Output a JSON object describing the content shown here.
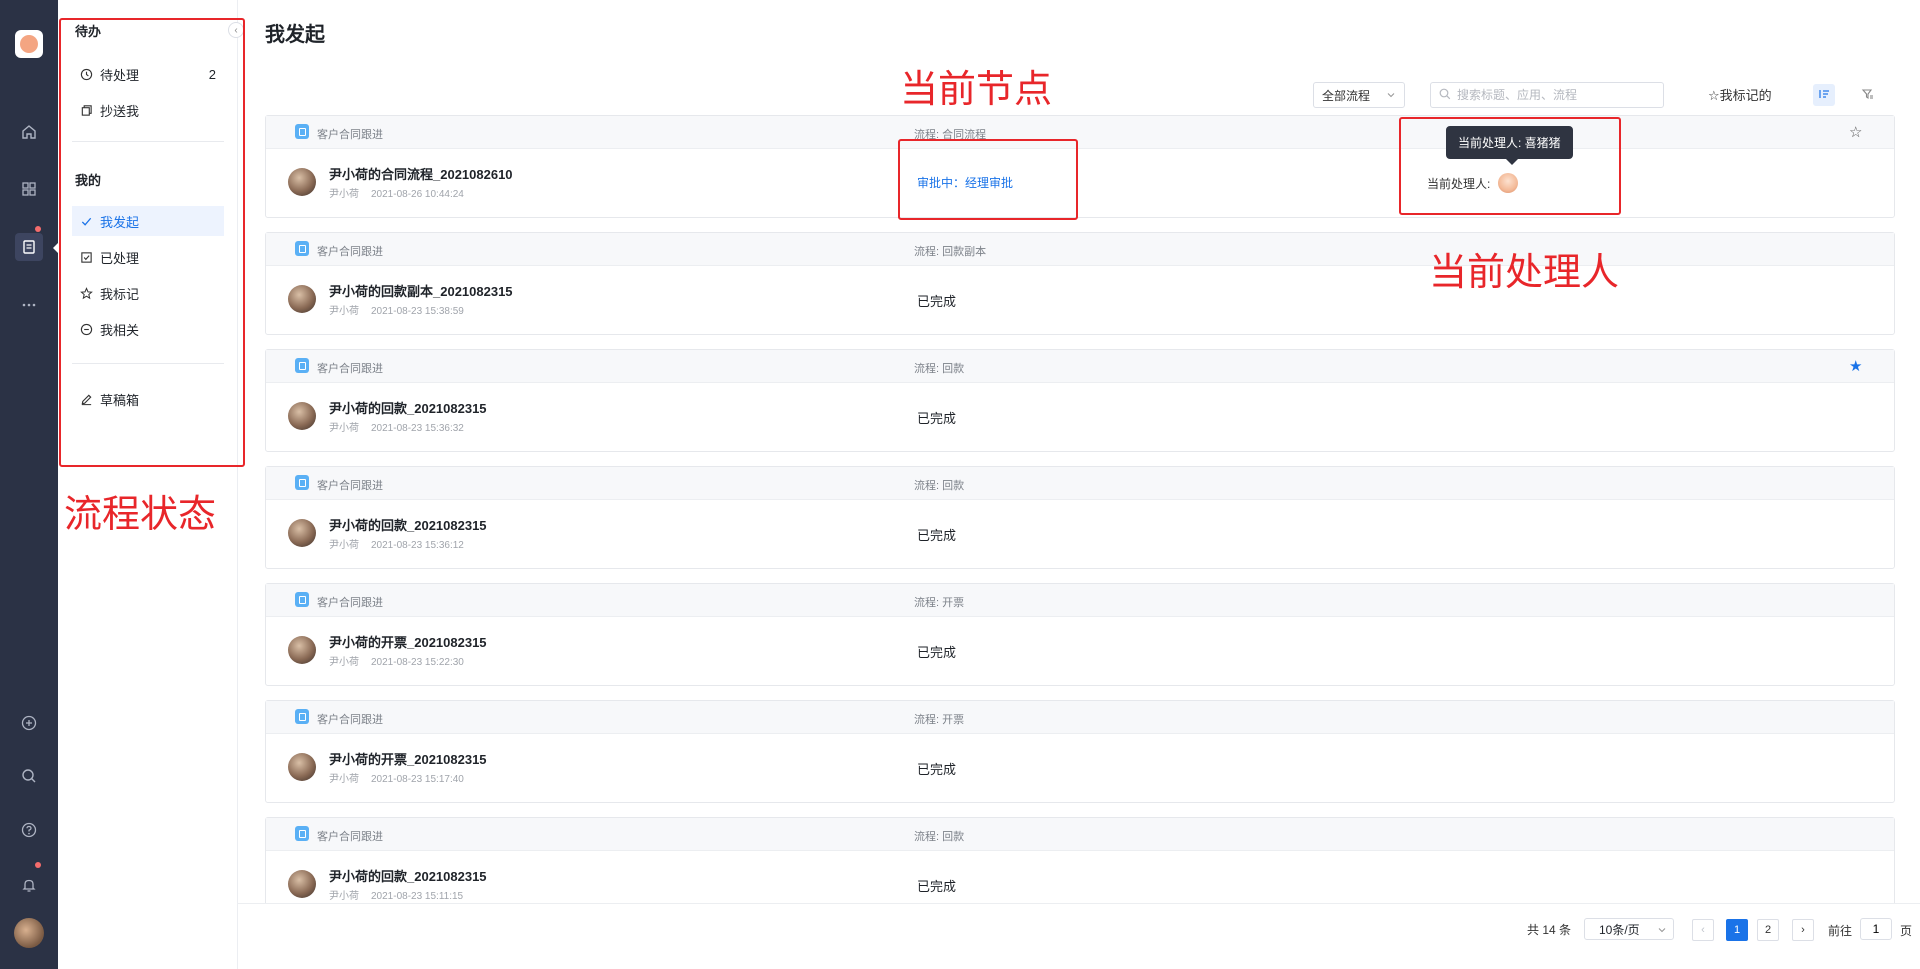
{
  "rail": {
    "items": [
      {
        "icon": "home-icon"
      },
      {
        "icon": "apps-icon"
      },
      {
        "icon": "workflow-icon",
        "active": true,
        "badge": true
      },
      {
        "icon": "more-icon"
      }
    ],
    "bottom": [
      {
        "icon": "add-circle-icon"
      },
      {
        "icon": "search-icon"
      },
      {
        "icon": "help-icon"
      },
      {
        "icon": "bell-icon",
        "badge": true
      }
    ]
  },
  "sidebar": {
    "todo_heading": "待办",
    "todo_items": [
      {
        "label": "待处理",
        "count": "2",
        "icon": "clock-icon"
      },
      {
        "label": "抄送我",
        "icon": "copy-icon"
      }
    ],
    "mine_heading": "我的",
    "mine_items": [
      {
        "label": "我发起",
        "icon": "check-icon",
        "active": true
      },
      {
        "label": "已处理",
        "icon": "checkbox-icon"
      },
      {
        "label": "我标记",
        "icon": "star-icon"
      },
      {
        "label": "我相关",
        "icon": "minus-circle-icon"
      }
    ],
    "draft_label": "草稿箱"
  },
  "page": {
    "title": "我发起",
    "filter_value": "全部流程",
    "search_placeholder": "搜索标题、应用、流程",
    "marked_label": "☆我标记的"
  },
  "annotations": {
    "node": "当前节点",
    "handler": "当前处理人",
    "status": "流程状态"
  },
  "tooltip": "当前处理人: 喜猪猪",
  "records": [
    {
      "app": "客户合同跟进",
      "flow": "流程: 合同流程",
      "title": "尹小荷的合同流程_2021082610",
      "user": "尹小荷",
      "time": "2021-08-26 10:44:24",
      "status": "审批中：经理审批",
      "pending": true,
      "handler_label": "当前处理人:",
      "starred": false
    },
    {
      "app": "客户合同跟进",
      "flow": "流程: 回款副本",
      "title": "尹小荷的回款副本_2021082315",
      "user": "尹小荷",
      "time": "2021-08-23 15:38:59",
      "status": "已完成",
      "starred": null
    },
    {
      "app": "客户合同跟进",
      "flow": "流程: 回款",
      "title": "尹小荷的回款_2021082315",
      "user": "尹小荷",
      "time": "2021-08-23 15:36:32",
      "status": "已完成",
      "starred": true
    },
    {
      "app": "客户合同跟进",
      "flow": "流程: 回款",
      "title": "尹小荷的回款_2021082315",
      "user": "尹小荷",
      "time": "2021-08-23 15:36:12",
      "status": "已完成",
      "starred": null
    },
    {
      "app": "客户合同跟进",
      "flow": "流程: 开票",
      "title": "尹小荷的开票_2021082315",
      "user": "尹小荷",
      "time": "2021-08-23 15:22:30",
      "status": "已完成",
      "starred": null
    },
    {
      "app": "客户合同跟进",
      "flow": "流程: 开票",
      "title": "尹小荷的开票_2021082315",
      "user": "尹小荷",
      "time": "2021-08-23 15:17:40",
      "status": "已完成",
      "starred": null
    },
    {
      "app": "客户合同跟进",
      "flow": "流程: 回款",
      "title": "尹小荷的回款_2021082315",
      "user": "尹小荷",
      "time": "2021-08-23 15:11:15",
      "status": "已完成",
      "starred": null
    }
  ],
  "pagination": {
    "total": "共 14 条",
    "page_size": "10条/页",
    "pages": [
      "1",
      "2"
    ],
    "current": "1",
    "goto_label": "前往",
    "goto_value": "1",
    "page_unit": "页"
  },
  "colors": {
    "accent": "#1a73e8",
    "annotation": "#e8262a",
    "rail": "#2b3245"
  }
}
